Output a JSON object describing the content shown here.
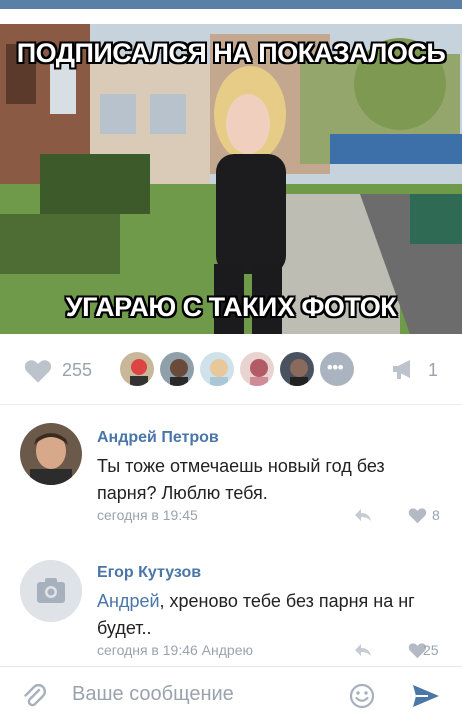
{
  "post": {
    "meme_top": "ПОДПИСАЛСЯ НА ПОКАЗАЛОСЬ",
    "meme_bottom": "УГАРАЮ С ТАКИХ ФОТОК"
  },
  "actions": {
    "like_count": "255",
    "share_count": "1",
    "likers": [
      "liker-1",
      "liker-2",
      "liker-3",
      "liker-4",
      "liker-5"
    ]
  },
  "comments": [
    {
      "author": "Андрей Петров",
      "text": "Ты тоже отмечаешь новый год без парня? Люблю тебя.",
      "time": "сегодня в 19:45",
      "likes": "8"
    },
    {
      "author": "Егор Кутузов",
      "mention": "Андрей",
      "text": ", хреново тебе без парня на нг будет..",
      "time": "сегодня в 19:46 Андрею",
      "likes": "25"
    }
  ],
  "composer": {
    "placeholder": "Ваше сообщение"
  },
  "colors": {
    "accent": "#4a76a8",
    "muted": "#9aa3ad",
    "topbar": "#5a80a8"
  }
}
